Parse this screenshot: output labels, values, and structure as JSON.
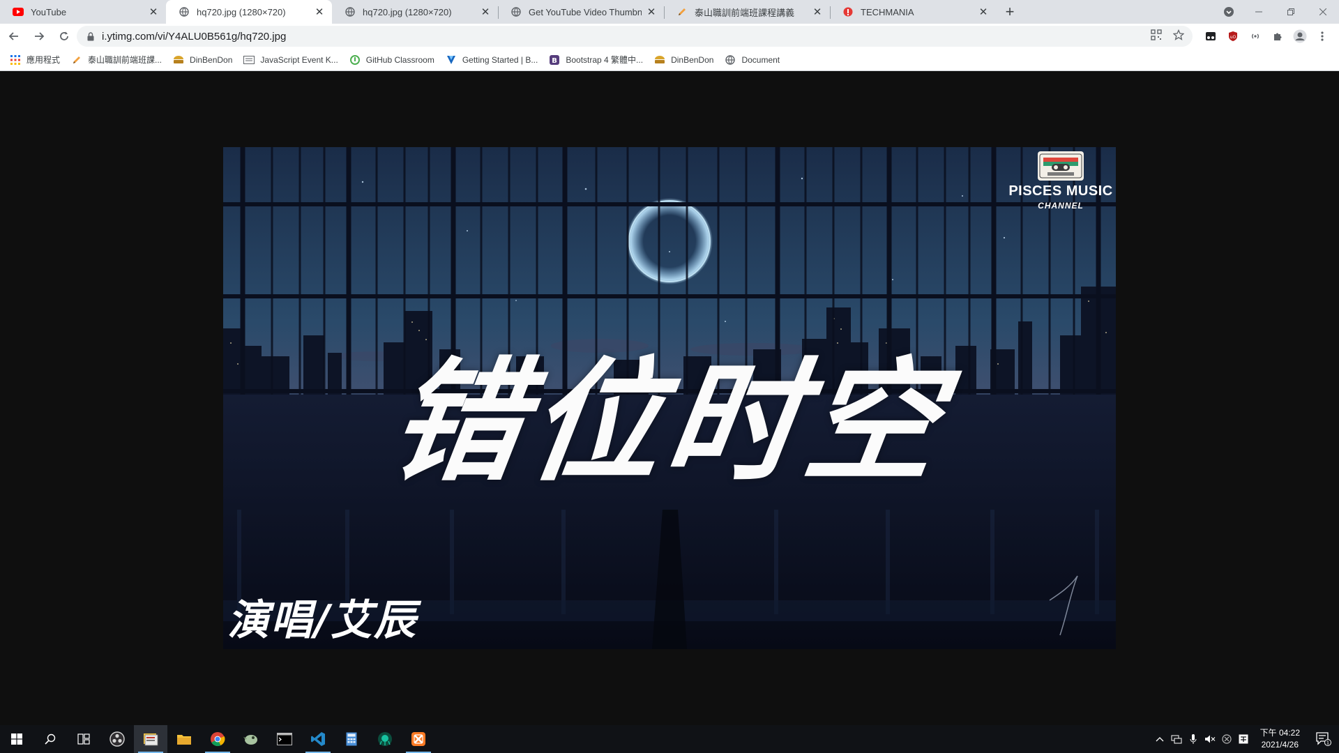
{
  "browser": {
    "tabs": [
      {
        "title": "YouTube",
        "favicon": "youtube-icon",
        "active": false
      },
      {
        "title": "hq720.jpg (1280×720)",
        "favicon": "globe-icon",
        "active": true
      },
      {
        "title": "hq720.jpg (1280×720)",
        "favicon": "globe-icon",
        "active": false
      },
      {
        "title": "Get YouTube Video Thumbnail",
        "favicon": "globe-icon",
        "active": false
      },
      {
        "title": "泰山職訓前端班課程講義",
        "favicon": "pencil-icon",
        "active": false
      },
      {
        "title": "TECHMANIA",
        "favicon": "techmania-icon",
        "active": false
      }
    ],
    "new_tab_label": "+",
    "url": "i.ytimg.com/vi/Y4ALU0B561g/hq720.jpg",
    "bookmarks": [
      {
        "label": "應用程式",
        "icon": "apps-grid-icon"
      },
      {
        "label": "泰山職訓前端班課...",
        "icon": "pencil-icon"
      },
      {
        "label": "DinBenDon",
        "icon": "bento-icon"
      },
      {
        "label": "JavaScript Event K...",
        "icon": "keyboard-icon"
      },
      {
        "label": "GitHub Classroom",
        "icon": "github-classroom-icon"
      },
      {
        "label": "Getting Started | B...",
        "icon": "vuetify-icon"
      },
      {
        "label": "Bootstrap 4 繁體中...",
        "icon": "bootstrap-icon"
      },
      {
        "label": "DinBenDon",
        "icon": "bento-icon"
      },
      {
        "label": "Document",
        "icon": "globe-icon"
      }
    ]
  },
  "image": {
    "song_title": "错位时空",
    "singer": "演唱/艾辰",
    "brand_name": "PISCES MUSIC",
    "brand_sub": "CHANNEL"
  },
  "taskbar": {
    "apps": [
      "windows-start-icon",
      "search-icon",
      "task-view-icon",
      "obs-icon",
      "app-window-icon",
      "file-explorer-icon",
      "chrome-icon",
      "bird-app-icon",
      "terminal-icon",
      "vscode-icon",
      "calculator-icon",
      "gitkraken-icon",
      "xampp-icon"
    ],
    "clock_time": "下午 04:22",
    "clock_date": "2021/4/26",
    "notification_count": "1"
  },
  "colors": {
    "tab_strip": "#dee1e6",
    "youtube_red": "#ff0000",
    "taskbar": "#101216",
    "page_bg": "#0f0f0f"
  }
}
